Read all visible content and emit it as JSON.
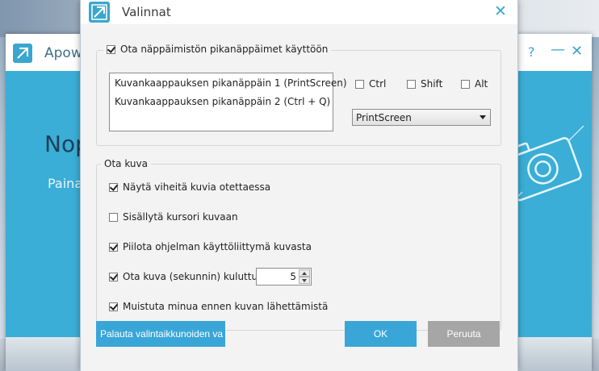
{
  "background_window": {
    "title": "Apowe",
    "help_glyph": "?",
    "minimize_glyph": "—",
    "close_glyph": "✕",
    "hero_title": "Nop",
    "hero_subtitle": "Paina",
    "accent_color": "#3aaed6"
  },
  "dialog": {
    "title": "Valinnat",
    "close_glyph": "✕",
    "hotkeys_group": {
      "enable_label": "Ota näppäimistön pikanäppäimet käyttöön",
      "enabled": true,
      "list": [
        "Kuvankaappauksen pikanäppäin 1  (PrintScreen)",
        "Kuvankaappauksen pikanäppäin 2  (Ctrl + Q)"
      ],
      "modifiers": [
        {
          "label": "Ctrl",
          "checked": false
        },
        {
          "label": "Shift",
          "checked": false
        },
        {
          "label": "Alt",
          "checked": false
        }
      ],
      "key_select": "PrintScreen"
    },
    "capture_group": {
      "legend": "Ota kuva",
      "options": [
        {
          "label": "Näytä viheitä kuvia otettaessa",
          "checked": true
        },
        {
          "label": "Sisällytä kursori kuvaan",
          "checked": false
        },
        {
          "label": "Piilota ohjelman käyttöliittymä kuvasta",
          "checked": true
        },
        {
          "label": "Ota kuva (sekunnin) kuluttua",
          "checked": true
        },
        {
          "label": "Muistuta minua ennen kuvan lähettämistä",
          "checked": true
        }
      ],
      "delay_value": "5"
    },
    "buttons": {
      "reset": "Palauta valintaikkunoiden va",
      "ok": "OK",
      "cancel": "Peruuta"
    }
  }
}
